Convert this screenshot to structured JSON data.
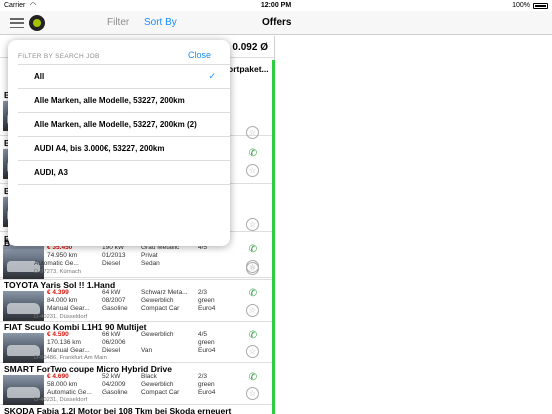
{
  "status_bar": {
    "carrier": "Carrier",
    "time": "12:00 PM",
    "battery": "100%"
  },
  "navbar": {
    "filter_label": "Filter",
    "sort_label": "Sort By",
    "title": "Offers"
  },
  "summary": {
    "count_text": "0.092 Ø",
    "partial_text": "ortpaket..."
  },
  "popover": {
    "header": "FILTER BY SEARCH JOB",
    "close_label": "Close",
    "items": [
      {
        "label": "All",
        "selected": true
      },
      {
        "label": "Alle Marken, alle Modelle, 53227, 200km"
      },
      {
        "label": "Alle Marken, alle Modelle, 53227, 200km (2)"
      },
      {
        "label": "AUDI A4, bis 3.000€, 53227, 200km"
      },
      {
        "label": "AUDI, A3"
      }
    ]
  },
  "listings": [
    {
      "title": "B",
      "price": "",
      "km": "",
      "trans": "",
      "loc": ""
    },
    {
      "title": "B",
      "price": "",
      "km": "",
      "trans": "",
      "loc": ""
    },
    {
      "title": "B",
      "price": "",
      "km": "",
      "trans": "",
      "loc": ""
    },
    {
      "title": "B",
      "price": "",
      "km": "",
      "trans": "",
      "loc": ""
    },
    {
      "title": "B",
      "price": "€ 35.450",
      "power": "190 kW",
      "color": "Grau Metallic",
      "doors": "4/5",
      "km": "74.950 km",
      "date": "01/2013",
      "seller": "Privat",
      "trans": "Automatic Ge...",
      "fuel": "Diesel",
      "body": "Sedan",
      "emission": "",
      "loc": "D-97273, Kürnach"
    },
    {
      "title": "TOYOTA Yaris Sol !! 1.Hand",
      "price": "€ 4.399",
      "power": "64 kW",
      "color": "Schwarz Meta...",
      "doors": "2/3",
      "km": "84.000 km",
      "date": "08/2007",
      "seller": "Gewerblich",
      "emission_color": "green",
      "trans": "Manual Gear...",
      "fuel": "Gasoline",
      "body": "Compact Car",
      "emission": "Euro4",
      "loc": "D-40231, Düsseldorf"
    },
    {
      "title": "FIAT Scudo Kombi L1H1 90 Multijet",
      "price": "€ 4.590",
      "power": "66 kW",
      "color": "Gewerblich",
      "doors": "4/5",
      "km": "170.136 km",
      "date": "06/2006",
      "seller": "",
      "emission_color": "green",
      "trans": "Manual Gear...",
      "fuel": "Diesel",
      "body": "Van",
      "emission": "Euro4",
      "loc": "D-60486, Frankfurt Am Main"
    },
    {
      "title": "SMART ForTwo coupe Micro Hybrid Drive",
      "price": "€ 4.690",
      "power": "52 kW",
      "color": "Black",
      "doors": "2/3",
      "km": "58.000 km",
      "date": "04/2009",
      "seller": "Gewerblich",
      "emission_color": "green",
      "trans": "Automatic Ge...",
      "fuel": "Gasoline",
      "body": "Compact Car",
      "emission": "Euro4",
      "loc": "D-40231, Düsseldorf"
    },
    {
      "title": "SKODA Fabia 1.2l Motor bei 108 Tkm bei Skoda erneuert",
      "price": "",
      "km": "",
      "trans": "",
      "loc": ""
    }
  ],
  "colors": {
    "accent": "#1a8cff",
    "price": "#d9140b",
    "phone": "#2a9d3c",
    "highlight": "#2ecc40"
  }
}
